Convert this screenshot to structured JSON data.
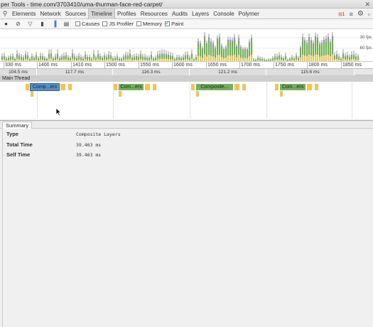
{
  "window": {
    "title": "per Tools - time.com/3703410/uma-thurman-face-red-carpet/",
    "close_glyph": "✕"
  },
  "tabs": {
    "search_glyph": "⚲",
    "items": [
      "Elements",
      "Network",
      "Sources",
      "Timeline",
      "Profiles",
      "Resources",
      "Audits",
      "Layers",
      "Console",
      "Polymer"
    ],
    "active": "Timeline",
    "error_badge": "⦻1",
    "settings_glyph": "⚙",
    "dock_glyph": "▫"
  },
  "toolbar": {
    "record_glyph": "●",
    "clear_glyph": "⃠",
    "filter_glyph": "▽",
    "trash_glyph": "▮",
    "bars_glyph": "▐",
    "film_glyph": "▤",
    "checks": [
      {
        "label": "Causes",
        "checked": false
      },
      {
        "label": "JS Profiler",
        "checked": false
      },
      {
        "label": "Memory",
        "checked": false
      },
      {
        "label": "Paint",
        "checked": true
      }
    ]
  },
  "overview": {
    "fps_labels": [
      "30 fps",
      "60 fps"
    ]
  },
  "ruler": {
    "ticks": [
      {
        "label": "330 ms",
        "ms": 1350
      },
      {
        "label": "1400 ms",
        "ms": 1400
      },
      {
        "label": "1410 ms",
        "ms": 1450
      },
      {
        "label": "1500 ms",
        "ms": 1500
      },
      {
        "label": "1550 ms",
        "ms": 1550
      },
      {
        "label": "1600 ms",
        "ms": 1600
      },
      {
        "label": "1650 ms",
        "ms": 1650
      },
      {
        "label": "1700 ms",
        "ms": 1700
      },
      {
        "label": "1750 ms",
        "ms": 1750
      },
      {
        "label": "1800 ms",
        "ms": 1800
      },
      {
        "label": "1850 ms",
        "ms": 1850
      }
    ]
  },
  "frames": [
    {
      "label": "104.5 ms",
      "start": 1345,
      "end": 1400
    },
    {
      "label": "117.7 ms",
      "start": 1400,
      "end": 1512
    },
    {
      "label": "116.3 ms",
      "start": 1512,
      "end": 1626
    },
    {
      "label": "121.2 ms",
      "start": 1626,
      "end": 1740
    },
    {
      "label": "115.6 ms",
      "start": 1740,
      "end": 1870
    }
  ],
  "main_thread": {
    "header": "Main Thread",
    "composites": [
      {
        "label": "Comp...ers",
        "start": 1390,
        "end": 1432,
        "color": "#5a8fc7"
      },
      {
        "label": "Com...ers",
        "start": 1521,
        "end": 1558,
        "color": "#72b25b"
      },
      {
        "label": "Composite...",
        "start": 1636,
        "end": 1690,
        "color": "#72b25b"
      },
      {
        "label": "Com...ers",
        "start": 1760,
        "end": 1798,
        "color": "#72b25b"
      }
    ]
  },
  "summary": {
    "tab_label": "Summary",
    "rows": [
      {
        "key": "Type",
        "value": "Composite Layers"
      },
      {
        "key": "Total Time",
        "value": "39.463 ms"
      },
      {
        "key": "Self Time",
        "value": "39.463 ms"
      }
    ]
  },
  "colors": {
    "paint_green": "#67b348",
    "script_yellow": "#f1c453",
    "rendering_purple": "#9b7fd1",
    "idle_gray": "#c9c9c9",
    "accent_blue": "#5a8fc7"
  }
}
